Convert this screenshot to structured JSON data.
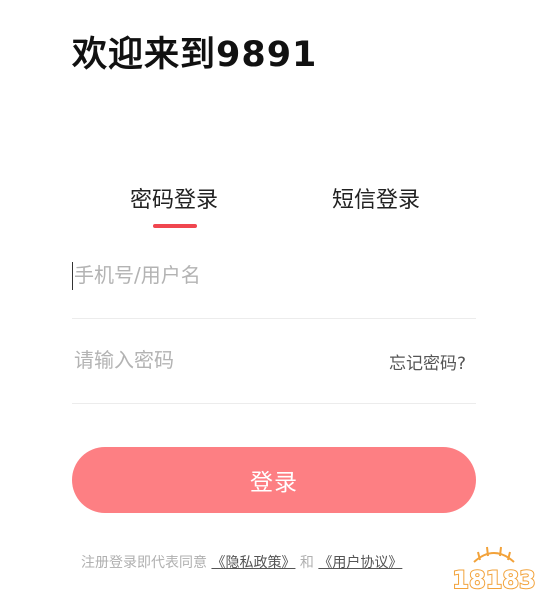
{
  "header": {
    "title": "欢迎来到9891"
  },
  "tabs": [
    {
      "label": "密码登录",
      "active": true
    },
    {
      "label": "短信登录",
      "active": false
    }
  ],
  "form": {
    "account_placeholder": "手机号/用户名",
    "password_placeholder": "请输入密码",
    "forgot_label": "忘记密码?",
    "submit_label": "登录"
  },
  "agreement": {
    "prefix": "注册登录即代表同意",
    "privacy_link": "《隐私政策》",
    "conjunction": "和",
    "terms_link": "《用户协议》"
  },
  "watermark": {
    "text": "18183"
  },
  "colors": {
    "accent": "#f0464f",
    "button": "#fd7f83",
    "placeholder": "#b3b3b3"
  }
}
